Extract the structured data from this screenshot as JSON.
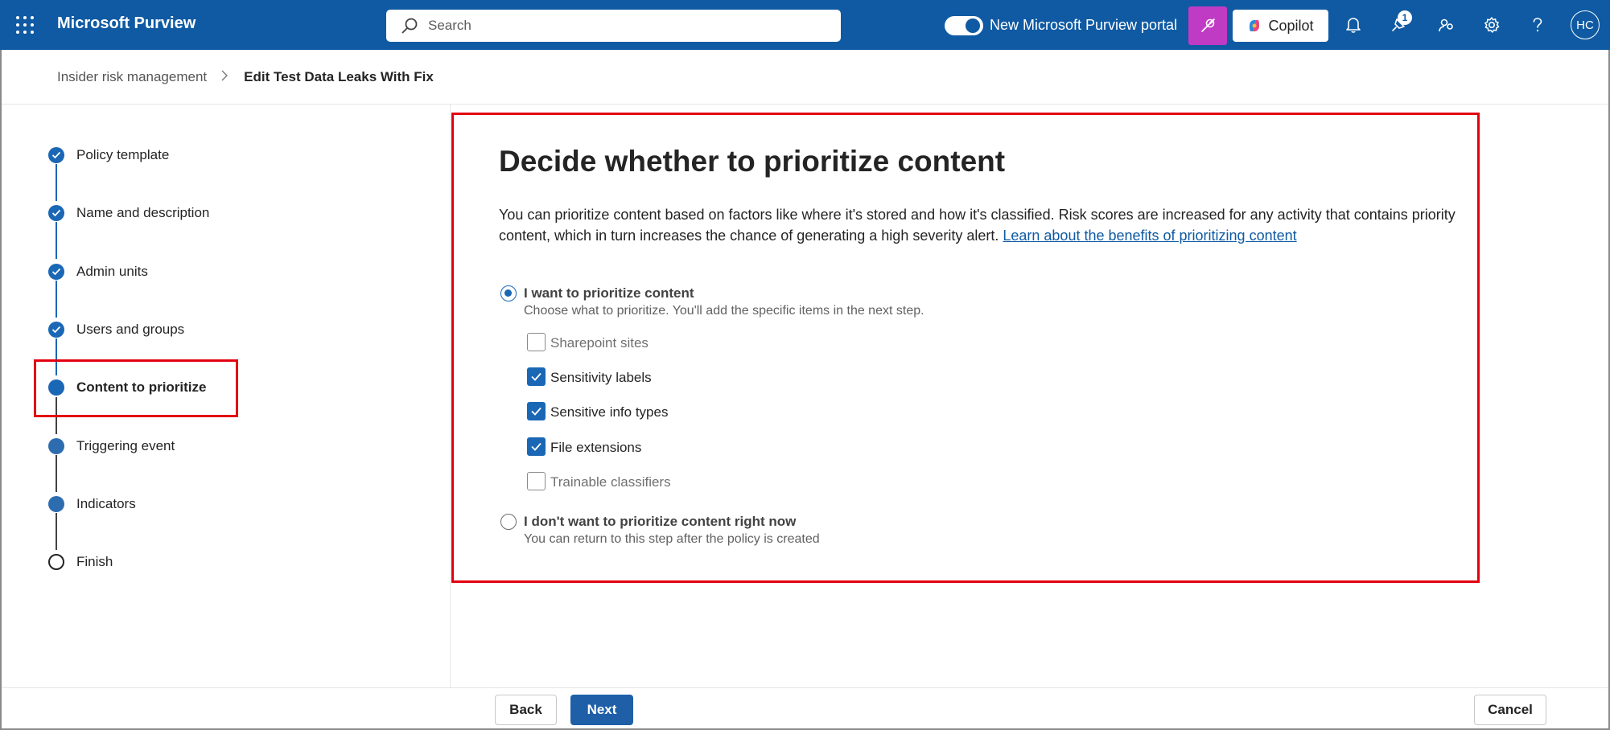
{
  "topbar": {
    "app_title": "Microsoft Purview",
    "search_placeholder": "Search",
    "portal_toggle_label": "New Microsoft Purview portal",
    "copilot_label": "Copilot",
    "notification_badge": "1",
    "avatar_initials": "HC",
    "bar_color": "#0f5aa3"
  },
  "breadcrumb": {
    "parent": "Insider risk management",
    "current": "Edit Test Data Leaks With Fix"
  },
  "steps": [
    {
      "label": "Policy template",
      "state": "done"
    },
    {
      "label": "Name and description",
      "state": "done"
    },
    {
      "label": "Admin units",
      "state": "done"
    },
    {
      "label": "Users and groups",
      "state": "done"
    },
    {
      "label": "Content to prioritize",
      "state": "current"
    },
    {
      "label": "Triggering event",
      "state": "todo"
    },
    {
      "label": "Indicators",
      "state": "todo"
    },
    {
      "label": "Finish",
      "state": "open"
    }
  ],
  "main": {
    "heading": "Decide whether to prioritize content",
    "description": "You can prioritize content based on factors like where it's stored and how it's classified. Risk scores are increased for any activity that contains priority content, which in turn increases the chance of generating a high severity alert. ",
    "learn_link": "Learn about the benefits of prioritizing content",
    "option_yes": {
      "label": "I want to prioritize content",
      "sub": "Choose what to prioritize. You'll add the specific items in the next step.",
      "selected": true
    },
    "checkboxes": [
      {
        "label": "Sharepoint sites",
        "checked": false
      },
      {
        "label": "Sensitivity labels",
        "checked": true
      },
      {
        "label": "Sensitive info types",
        "checked": true
      },
      {
        "label": "File extensions",
        "checked": true
      },
      {
        "label": "Trainable classifiers",
        "checked": false
      }
    ],
    "option_no": {
      "label": "I don't want to prioritize content right now",
      "sub": "You can return to this step after the policy is created",
      "selected": false
    }
  },
  "footer": {
    "back_label": "Back",
    "next_label": "Next",
    "cancel_label": "Cancel"
  }
}
